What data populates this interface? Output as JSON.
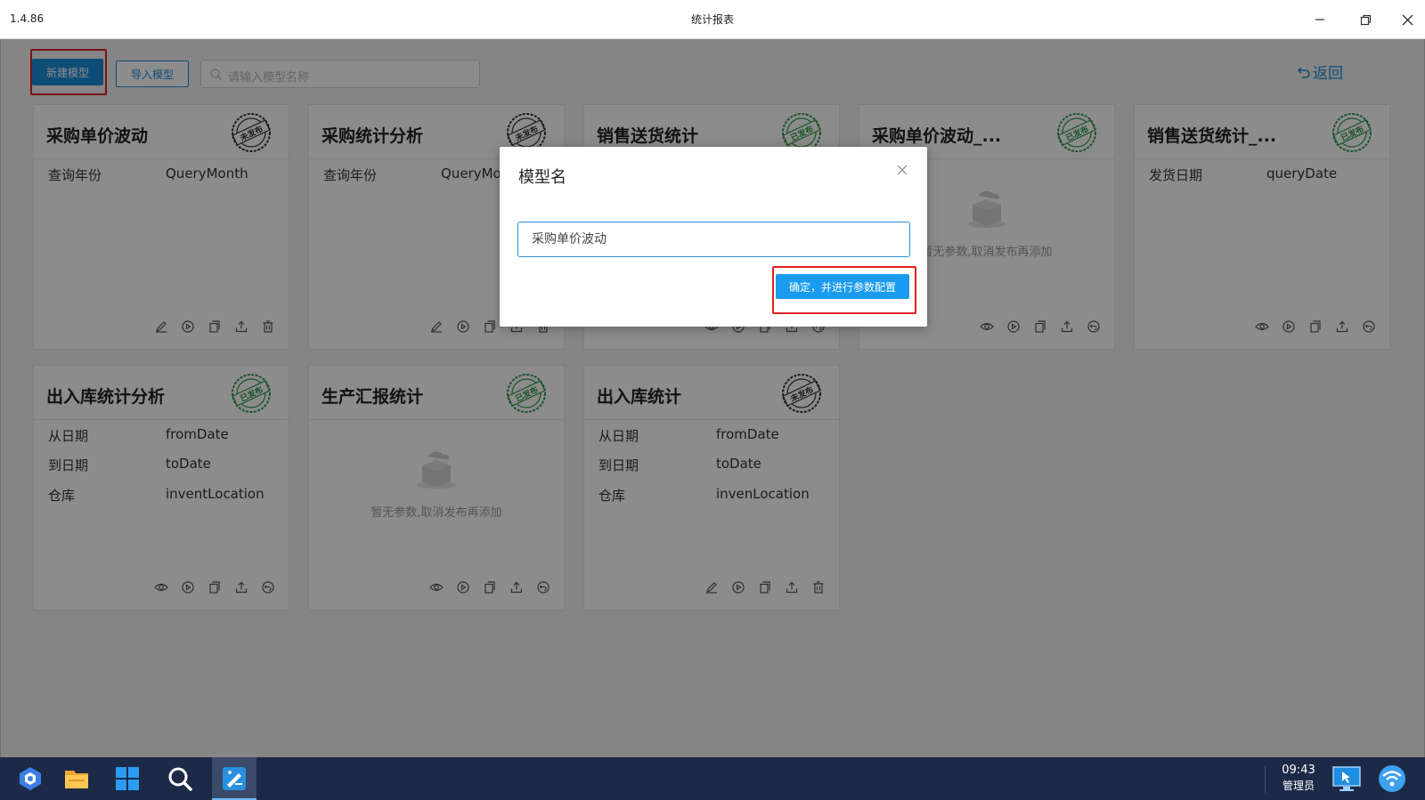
{
  "window": {
    "version": "1.4.86",
    "title": "统计报表"
  },
  "toolbar": {
    "new_model": "新建模型",
    "import_model": "导入模型",
    "search_placeholder": "请输入模型名称",
    "back": "返回"
  },
  "stamps": {
    "published": "已发布",
    "unpublished": "未发布"
  },
  "cards": [
    {
      "title": "采购单价波动",
      "status": "未发布",
      "params": [
        {
          "name": "查询年份",
          "value": "QueryMonth"
        }
      ]
    },
    {
      "title": "采购统计分析",
      "status": "未发布",
      "params": [
        {
          "name": "查询年份",
          "value": "QueryMonth"
        }
      ]
    },
    {
      "title": "销售送货统计",
      "status": "已发布",
      "params": []
    },
    {
      "title": "采购单价波动_...",
      "status": "已发布",
      "params": [],
      "empty_text": "暂无参数,取消发布再添加"
    },
    {
      "title": "销售送货统计_...",
      "status": "已发布",
      "params": [
        {
          "name": "发货日期",
          "value": "queryDate"
        }
      ]
    },
    {
      "title": "出入库统计分析",
      "status": "已发布",
      "params": [
        {
          "name": "从日期",
          "value": "fromDate"
        },
        {
          "name": "到日期",
          "value": "toDate"
        },
        {
          "name": "仓库",
          "value": "inventLocation"
        }
      ]
    },
    {
      "title": "生产汇报统计",
      "status": "已发布",
      "params": [],
      "empty_text": "暂无参数,取消发布再添加"
    },
    {
      "title": "出入库统计",
      "status": "未发布",
      "params": [
        {
          "name": "从日期",
          "value": "fromDate"
        },
        {
          "name": "到日期",
          "value": "toDate"
        },
        {
          "name": "仓库",
          "value": "invenLocation"
        }
      ]
    }
  ],
  "modal": {
    "title": "模型名",
    "input_value": "采购单价波动",
    "confirm": "确定，并进行参数配置"
  },
  "taskbar": {
    "time": "09:43",
    "user": "管理员"
  },
  "colors": {
    "accent": "#1a8cd8",
    "highlight": "#e02020",
    "published": "#2e9a48",
    "unpublished": "#333333",
    "taskbar": "#1d2a47"
  }
}
